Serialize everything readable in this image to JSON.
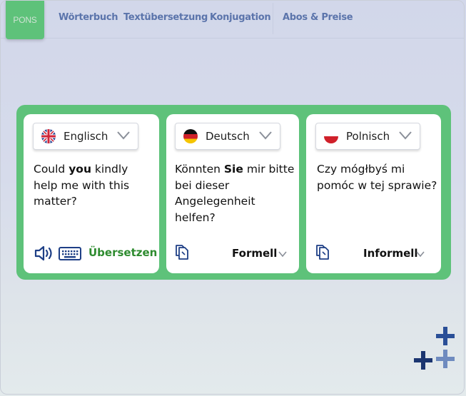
{
  "header": {
    "logo": "PONS",
    "nav": [
      {
        "label": "Wörterbuch"
      },
      {
        "label": "Textübersetzung"
      },
      {
        "label": "Konjugation"
      },
      {
        "label": "Abos & Preise"
      }
    ]
  },
  "cards": [
    {
      "language": "Englisch",
      "flag_icon": "uk-flag-icon",
      "text_before": "Could ",
      "text_bold": "you",
      "text_after": " kindly help me with this matter?",
      "translate_label": "Übersetzen"
    },
    {
      "language": "Deutsch",
      "flag_icon": "german-flag-icon",
      "text_before": "Könnten ",
      "text_bold": "Sie",
      "text_after": " mir bitte bei dieser Angelegenheit helfen?",
      "register": "Formell"
    },
    {
      "language": "Polnisch",
      "flag_icon": "polish-flag-icon",
      "text_before": "Czy mógłbyś mi pomóc w tej sprawie?",
      "text_bold": "",
      "text_after": "",
      "register": "Informell"
    }
  ],
  "colors": {
    "accent_green": "#5ec27a",
    "translate_green": "#2e8b2f",
    "nav_blue": "#5b74ab",
    "icon_navy": "#1e3f86"
  }
}
